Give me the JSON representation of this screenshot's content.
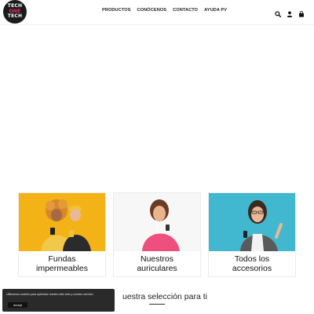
{
  "logo": {
    "line1": "TECH",
    "line2": "ONE",
    "line3": "TECH"
  },
  "nav": [
    "PRODUCTOS",
    "CONÓCENOS",
    "CONTACTO",
    "AYUDA PV"
  ],
  "header_icons": [
    "search-icon",
    "user-icon",
    "cart-icon"
  ],
  "cards": [
    {
      "title_line1": "Fundas",
      "title_line2": "impermeables"
    },
    {
      "title_line1": "Nuestros",
      "title_line2": "auriculares"
    },
    {
      "title_line1": "Todos los",
      "title_line2": "accesorios"
    }
  ],
  "section_title": "uestra selección para ti",
  "cookie": {
    "text": "Utilizamos cookies para optimizar nuestro sitio web y nuestro servicio.",
    "accept_label": "Accept"
  },
  "colors": {
    "accent": "#e8306f",
    "card1_bg": "#f3b316",
    "card2_bg": "#f7f7f7",
    "card3_bg": "#42b8d0",
    "banner_bg": "#2a2a2a"
  }
}
